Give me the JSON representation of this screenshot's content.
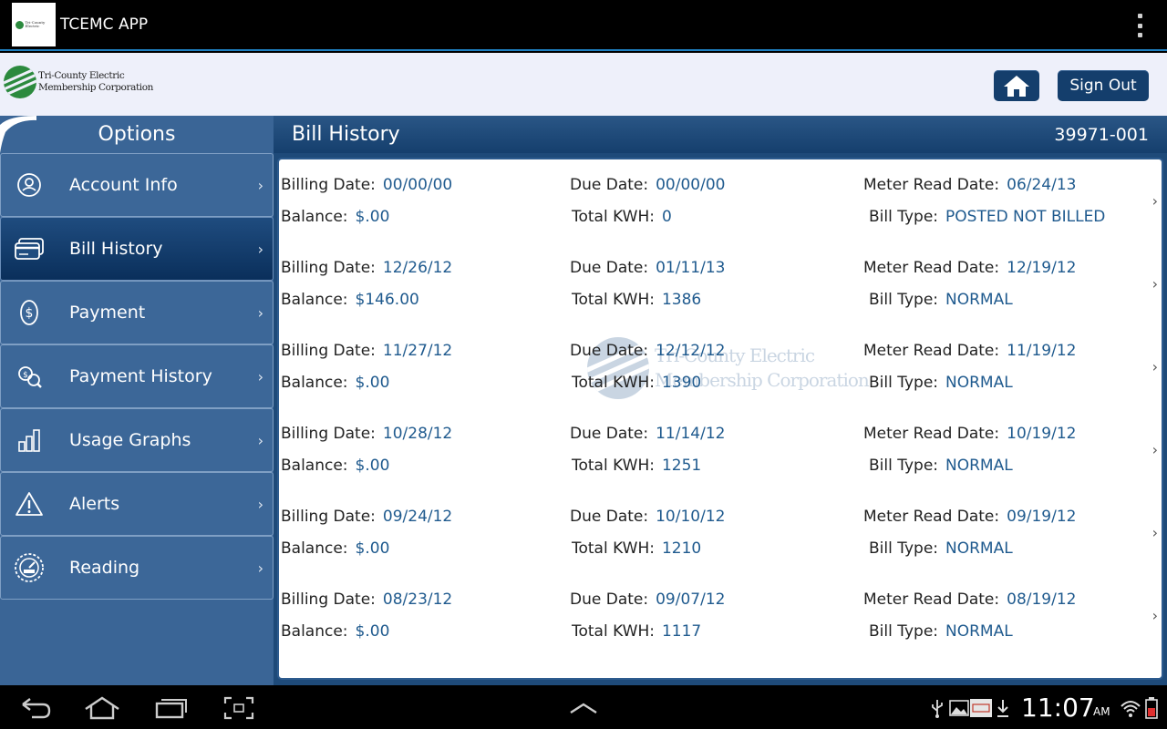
{
  "app": {
    "title": "TCEMC APP"
  },
  "header": {
    "logo_line1": "Tri-County Electric",
    "logo_line2": "Membership Corporation",
    "signout_label": "Sign Out"
  },
  "sidebar": {
    "title": "Options",
    "items": [
      {
        "label": "Account Info",
        "icon": "user-icon"
      },
      {
        "label": "Bill History",
        "icon": "credit-card-icon",
        "active": true
      },
      {
        "label": "Payment",
        "icon": "dollar-icon"
      },
      {
        "label": "Payment History",
        "icon": "search-money-icon"
      },
      {
        "label": "Usage Graphs",
        "icon": "bar-chart-icon"
      },
      {
        "label": "Alerts",
        "icon": "warning-icon"
      },
      {
        "label": "Reading",
        "icon": "meter-icon"
      }
    ]
  },
  "main": {
    "title": "Bill History",
    "account_number": "39971-001",
    "labels": {
      "billing_date": "Billing Date:",
      "due_date": "Due Date:",
      "meter_read_date": "Meter Read Date:",
      "balance": "Balance:",
      "total_kwh": "Total KWH:",
      "bill_type": "Bill Type:"
    },
    "bills": [
      {
        "billing_date": "00/00/00",
        "due_date": "00/00/00",
        "meter_read_date": "06/24/13",
        "balance": "$.00",
        "total_kwh": "0",
        "bill_type": "POSTED NOT BILLED"
      },
      {
        "billing_date": "12/26/12",
        "due_date": "01/11/13",
        "meter_read_date": "12/19/12",
        "balance": "$146.00",
        "total_kwh": "1386",
        "bill_type": "NORMAL"
      },
      {
        "billing_date": "11/27/12",
        "due_date": "12/12/12",
        "meter_read_date": "11/19/12",
        "balance": "$.00",
        "total_kwh": "1390",
        "bill_type": "NORMAL"
      },
      {
        "billing_date": "10/28/12",
        "due_date": "11/14/12",
        "meter_read_date": "10/19/12",
        "balance": "$.00",
        "total_kwh": "1251",
        "bill_type": "NORMAL"
      },
      {
        "billing_date": "09/24/12",
        "due_date": "10/10/12",
        "meter_read_date": "09/19/12",
        "balance": "$.00",
        "total_kwh": "1210",
        "bill_type": "NORMAL"
      },
      {
        "billing_date": "08/23/12",
        "due_date": "09/07/12",
        "meter_read_date": "08/19/12",
        "balance": "$.00",
        "total_kwh": "1117",
        "bill_type": "NORMAL"
      }
    ]
  },
  "statusbar": {
    "time": "11:07",
    "ampm": "AM"
  },
  "colors": {
    "accent": "#1f7fbf",
    "sidebar": "#3a6596",
    "active": "#0d3462",
    "value_text": "#1f5a8e",
    "brand_green": "#2c8a3e"
  }
}
